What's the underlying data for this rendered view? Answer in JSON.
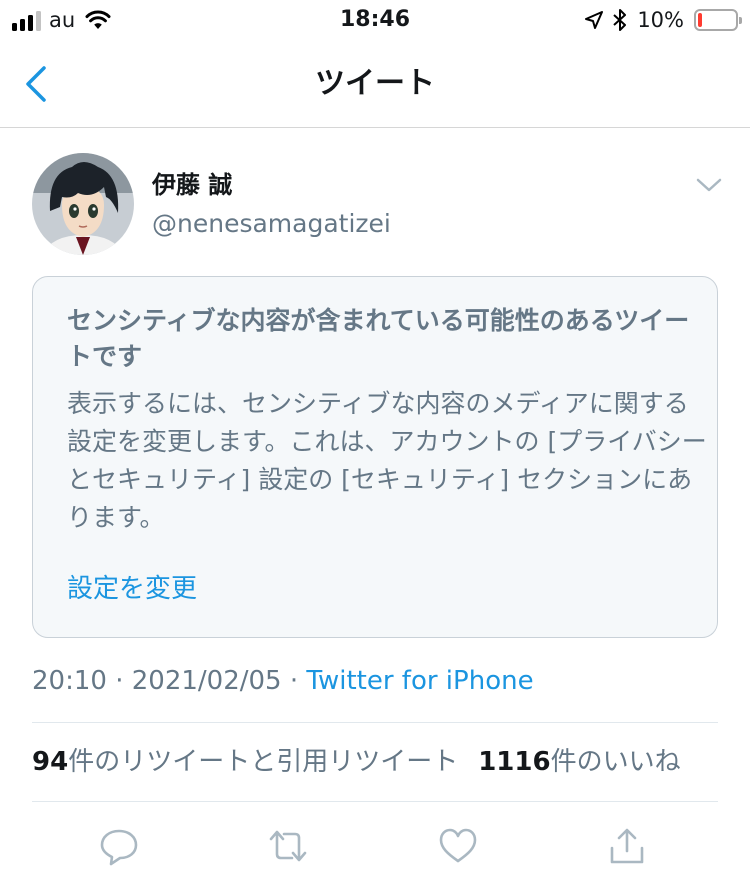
{
  "status_bar": {
    "carrier": "au",
    "time": "18:46",
    "battery_percent": "10%",
    "battery_level": 0.1,
    "signal_bars": 3,
    "signal_total": 4
  },
  "nav": {
    "title": "ツイート",
    "back_icon": "chevron-left-icon"
  },
  "author": {
    "name": "伊藤 誠",
    "handle": "@nenesamagatizei"
  },
  "sensitive": {
    "title": "センシティブな内容が含まれている可能性のあるツイートです",
    "body": "表示するには、センシティブな内容のメディアに関する設定を変更します。これは、アカウントの [プライバシーとセキュリティ] 設定の [セキュリティ] セクションにあります。",
    "link": "設定を変更"
  },
  "meta": {
    "time": "20:10",
    "separator": "·",
    "date": "2021/02/05",
    "source": "Twitter for iPhone"
  },
  "stats": {
    "retweets_count": "94",
    "retweets_label": "件のリツイートと引用リツイート",
    "likes_count": "1116",
    "likes_label": "件のいいね"
  },
  "actions": {
    "icons": [
      "reply-icon",
      "retweet-icon",
      "like-icon",
      "share-icon"
    ]
  },
  "colors": {
    "accent": "#1b95e0",
    "secondary_text": "#657786",
    "box_background": "#f5f8fa",
    "battery_low": "#ff3b30"
  }
}
